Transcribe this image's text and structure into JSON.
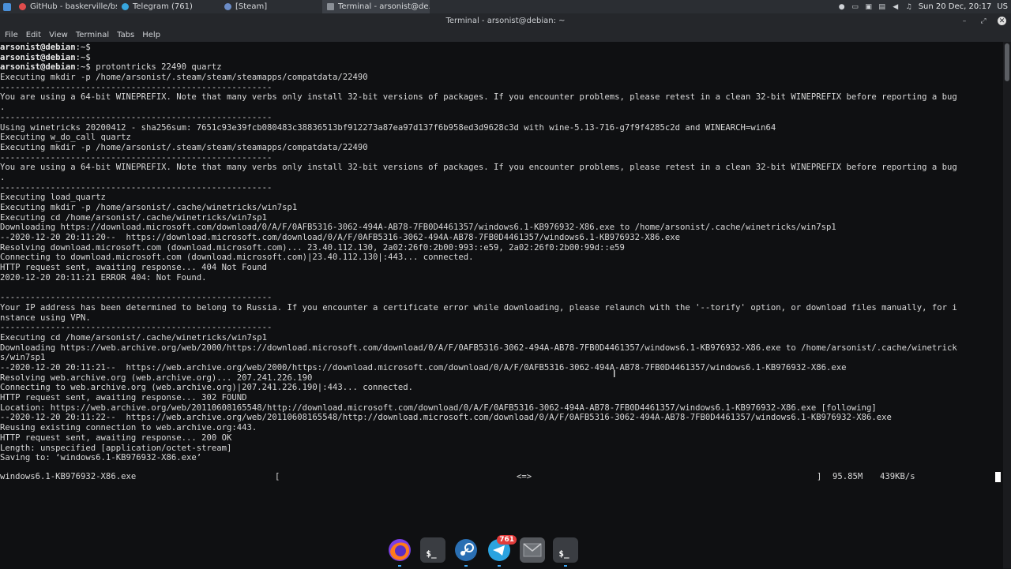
{
  "taskbar": {
    "tasks": [
      {
        "label": "GitHub - baskerville/bs...",
        "icon": "github-icon",
        "color": "#e04c4c"
      },
      {
        "label": "Telegram (761)",
        "icon": "telegram-icon",
        "color": "#37a6de"
      },
      {
        "label": "[Steam]",
        "icon": "steam-icon",
        "color": "#6b8cc7"
      },
      {
        "label": "Terminal - arsonist@de...",
        "icon": "terminal-icon",
        "color": "#8a8f96"
      }
    ],
    "clock": "Sun 20 Dec, 20:17",
    "keyboard_layout": "US"
  },
  "window": {
    "title": "Terminal - arsonist@debian: ~"
  },
  "menu": [
    "File",
    "Edit",
    "View",
    "Terminal",
    "Tabs",
    "Help"
  ],
  "prompt": {
    "user": "arsonist@debian",
    "path": ":~$"
  },
  "terminal_lines": [
    {
      "type": "prompt",
      "cmd": ""
    },
    {
      "type": "prompt",
      "cmd": ""
    },
    {
      "type": "prompt",
      "cmd": " protontricks 22490 quartz"
    },
    {
      "type": "text",
      "text": "Executing mkdir -p /home/arsonist/.steam/steam/steamapps/compatdata/22490"
    },
    {
      "type": "text",
      "text": "------------------------------------------------------"
    },
    {
      "type": "text",
      "text": "You are using a 64-bit WINEPREFIX. Note that many verbs only install 32-bit versions of packages. If you encounter problems, please retest in a clean 32-bit WINEPREFIX before reporting a bug"
    },
    {
      "type": "text",
      "text": "."
    },
    {
      "type": "text",
      "text": "------------------------------------------------------"
    },
    {
      "type": "text",
      "text": "Using winetricks 20200412 - sha256sum: 7651c93e39fcb080483c38836513bf912273a87ea97d137f6b958ed3d9628c3d with wine-5.13-716-g7f9f4285c2d and WINEARCH=win64"
    },
    {
      "type": "text",
      "text": "Executing w_do_call quartz"
    },
    {
      "type": "text",
      "text": "Executing mkdir -p /home/arsonist/.steam/steam/steamapps/compatdata/22490"
    },
    {
      "type": "text",
      "text": "------------------------------------------------------"
    },
    {
      "type": "text",
      "text": "You are using a 64-bit WINEPREFIX. Note that many verbs only install 32-bit versions of packages. If you encounter problems, please retest in a clean 32-bit WINEPREFIX before reporting a bug"
    },
    {
      "type": "text",
      "text": "."
    },
    {
      "type": "text",
      "text": "------------------------------------------------------"
    },
    {
      "type": "text",
      "text": "Executing load_quartz"
    },
    {
      "type": "text",
      "text": "Executing mkdir -p /home/arsonist/.cache/winetricks/win7sp1"
    },
    {
      "type": "text",
      "text": "Executing cd /home/arsonist/.cache/winetricks/win7sp1"
    },
    {
      "type": "text",
      "text": "Downloading https://download.microsoft.com/download/0/A/F/0AFB5316-3062-494A-AB78-7FB0D4461357/windows6.1-KB976932-X86.exe to /home/arsonist/.cache/winetricks/win7sp1"
    },
    {
      "type": "text",
      "text": "--2020-12-20 20:11:20--  https://download.microsoft.com/download/0/A/F/0AFB5316-3062-494A-AB78-7FB0D4461357/windows6.1-KB976932-X86.exe"
    },
    {
      "type": "text",
      "text": "Resolving download.microsoft.com (download.microsoft.com)... 23.40.112.130, 2a02:26f0:2b00:993::e59, 2a02:26f0:2b00:99d::e59"
    },
    {
      "type": "text",
      "text": "Connecting to download.microsoft.com (download.microsoft.com)|23.40.112.130|:443... connected."
    },
    {
      "type": "text",
      "text": "HTTP request sent, awaiting response... 404 Not Found"
    },
    {
      "type": "text",
      "text": "2020-12-20 20:11:21 ERROR 404: Not Found."
    },
    {
      "type": "text",
      "text": ""
    },
    {
      "type": "text",
      "text": "------------------------------------------------------"
    },
    {
      "type": "text",
      "text": "Your IP address has been determined to belong to Russia. If you encounter a certificate error while downloading, please relaunch with the '--torify' option, or download files manually, for i"
    },
    {
      "type": "text",
      "text": "nstance using VPN."
    },
    {
      "type": "text",
      "text": "------------------------------------------------------"
    },
    {
      "type": "text",
      "text": "Executing cd /home/arsonist/.cache/winetricks/win7sp1"
    },
    {
      "type": "text",
      "text": "Downloading https://web.archive.org/web/2000/https://download.microsoft.com/download/0/A/F/0AFB5316-3062-494A-AB78-7FB0D4461357/windows6.1-KB976932-X86.exe to /home/arsonist/.cache/winetrick"
    },
    {
      "type": "text",
      "text": "s/win7sp1"
    },
    {
      "type": "text",
      "text": "--2020-12-20 20:11:21--  https://web.archive.org/web/2000/https://download.microsoft.com/download/0/A/F/0AFB5316-3062-494A-AB78-7FB0D4461357/windows6.1-KB976932-X86.exe"
    },
    {
      "type": "text",
      "text": "Resolving web.archive.org (web.archive.org)... 207.241.226.190"
    },
    {
      "type": "text",
      "text": "Connecting to web.archive.org (web.archive.org)|207.241.226.190|:443... connected."
    },
    {
      "type": "text",
      "text": "HTTP request sent, awaiting response... 302 FOUND"
    },
    {
      "type": "text",
      "text": "Location: https://web.archive.org/web/20110608165548/http://download.microsoft.com/download/0/A/F/0AFB5316-3062-494A-AB78-7FB0D4461357/windows6.1-KB976932-X86.exe [following]"
    },
    {
      "type": "text",
      "text": "--2020-12-20 20:11:22--  https://web.archive.org/web/20110608165548/http://download.microsoft.com/download/0/A/F/0AFB5316-3062-494A-AB78-7FB0D4461357/windows6.1-KB976932-X86.exe"
    },
    {
      "type": "text",
      "text": "Reusing existing connection to web.archive.org:443."
    },
    {
      "type": "text",
      "text": "HTTP request sent, awaiting response... 200 OK"
    },
    {
      "type": "text",
      "text": "Length: unspecified [application/octet-stream]"
    },
    {
      "type": "text",
      "text": "Saving to: ‘windows6.1-KB976932-X86.exe’"
    }
  ],
  "progress": {
    "filename": "windows6.1-KB976932-X86.exe",
    "bar_open": "[",
    "bar_indicator": "<=>",
    "bar_close": "]",
    "size": "95.85M",
    "rate": "439KB/s"
  },
  "dock": {
    "apps": [
      {
        "name": "firefox",
        "icon": "firefox-icon"
      },
      {
        "name": "terminal",
        "icon": "terminal-icon",
        "glyph": "$_"
      },
      {
        "name": "steam",
        "icon": "steam-icon"
      },
      {
        "name": "telegram",
        "icon": "telegram-icon",
        "badge": "761"
      },
      {
        "name": "mail",
        "icon": "mail-icon"
      },
      {
        "name": "terminal",
        "icon": "terminal-icon",
        "glyph": "$_"
      }
    ]
  }
}
